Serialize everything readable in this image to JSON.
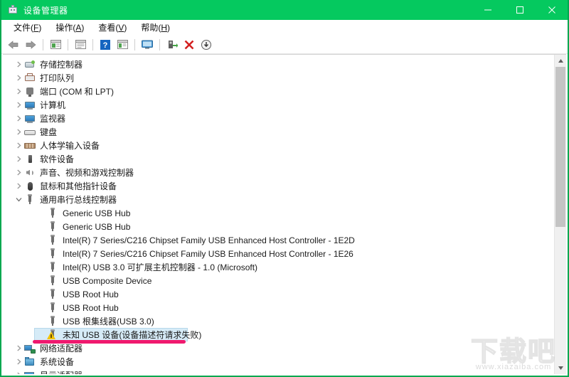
{
  "window": {
    "title": "设备管理器",
    "icon": "device-manager-icon",
    "accent_color": "#05c95f",
    "controls": [
      {
        "name": "minimize",
        "glyph": "minimize-icon"
      },
      {
        "name": "maximize",
        "glyph": "maximize-icon"
      },
      {
        "name": "close",
        "glyph": "close-icon"
      }
    ]
  },
  "menubar": {
    "items": [
      {
        "label": "文件(F)",
        "text": "文件(",
        "accel": "F",
        "tail": ")"
      },
      {
        "label": "操作(A)",
        "text": "操作(",
        "accel": "A",
        "tail": ")"
      },
      {
        "label": "查看(V)",
        "text": "查看(",
        "accel": "V",
        "tail": ")"
      },
      {
        "label": "帮助(H)",
        "text": "帮助(",
        "accel": "H",
        "tail": ")"
      }
    ]
  },
  "toolbar": {
    "buttons": [
      {
        "name": "back-icon"
      },
      {
        "name": "forward-icon"
      },
      {
        "name": "properties-icon"
      },
      {
        "name": "show-hidden-devices-icon"
      },
      {
        "name": "help-icon"
      },
      {
        "name": "update-driver-icon"
      },
      {
        "name": "scan-hardware-changes-icon"
      },
      {
        "name": "enable-device-icon"
      },
      {
        "name": "uninstall-device-icon"
      },
      {
        "name": "download-driver-icon"
      }
    ]
  },
  "tree": {
    "rows": [
      {
        "label": "存储控制器",
        "depth": 1,
        "expanded": false,
        "icon": "storage-controller-icon",
        "selected": false
      },
      {
        "label": "打印队列",
        "depth": 1,
        "expanded": false,
        "icon": "print-queue-icon",
        "selected": false
      },
      {
        "label": "端口 (COM 和 LPT)",
        "depth": 1,
        "expanded": false,
        "icon": "port-icon",
        "selected": false
      },
      {
        "label": "计算机",
        "depth": 1,
        "expanded": false,
        "icon": "computer-icon",
        "selected": false
      },
      {
        "label": "监视器",
        "depth": 1,
        "expanded": false,
        "icon": "monitor-icon",
        "selected": false
      },
      {
        "label": "键盘",
        "depth": 1,
        "expanded": false,
        "icon": "keyboard-icon",
        "selected": false
      },
      {
        "label": "人体学输入设备",
        "depth": 1,
        "expanded": false,
        "icon": "hid-icon",
        "selected": false
      },
      {
        "label": "软件设备",
        "depth": 1,
        "expanded": false,
        "icon": "software-device-icon",
        "selected": false
      },
      {
        "label": "声音、视频和游戏控制器",
        "depth": 1,
        "expanded": false,
        "icon": "sound-icon",
        "selected": false
      },
      {
        "label": "鼠标和其他指针设备",
        "depth": 1,
        "expanded": false,
        "icon": "mouse-icon",
        "selected": false
      },
      {
        "label": "通用串行总线控制器",
        "depth": 1,
        "expanded": true,
        "icon": "usb-icon",
        "selected": false
      },
      {
        "label": "Generic USB Hub",
        "depth": 2,
        "expanded": null,
        "icon": "usb-icon",
        "selected": false
      },
      {
        "label": "Generic USB Hub",
        "depth": 2,
        "expanded": null,
        "icon": "usb-icon",
        "selected": false
      },
      {
        "label": "Intel(R) 7 Series/C216 Chipset Family USB Enhanced Host Controller - 1E2D",
        "depth": 2,
        "expanded": null,
        "icon": "usb-icon",
        "selected": false
      },
      {
        "label": "Intel(R) 7 Series/C216 Chipset Family USB Enhanced Host Controller - 1E26",
        "depth": 2,
        "expanded": null,
        "icon": "usb-icon",
        "selected": false
      },
      {
        "label": "Intel(R) USB 3.0 可扩展主机控制器 - 1.0 (Microsoft)",
        "depth": 2,
        "expanded": null,
        "icon": "usb-icon",
        "selected": false
      },
      {
        "label": "USB Composite Device",
        "depth": 2,
        "expanded": null,
        "icon": "usb-icon",
        "selected": false
      },
      {
        "label": "USB Root Hub",
        "depth": 2,
        "expanded": null,
        "icon": "usb-icon",
        "selected": false
      },
      {
        "label": "USB Root Hub",
        "depth": 2,
        "expanded": null,
        "icon": "usb-icon",
        "selected": false
      },
      {
        "label": "USB 根集线器(USB 3.0)",
        "depth": 2,
        "expanded": null,
        "icon": "usb-icon",
        "selected": false
      },
      {
        "label": "未知 USB 设备(设备描述符请求失败)",
        "depth": 2,
        "expanded": null,
        "icon": "warning-icon",
        "selected": true
      },
      {
        "label": "网络适配器",
        "depth": 1,
        "expanded": false,
        "icon": "network-adapter-icon",
        "selected": false
      },
      {
        "label": "系统设备",
        "depth": 1,
        "expanded": false,
        "icon": "system-device-icon",
        "selected": false
      },
      {
        "label": "显示适配器",
        "depth": 1,
        "expanded": false,
        "icon": "display-adapter-icon",
        "selected": false
      }
    ]
  },
  "scrollbar": {
    "up_glyph": "chevron-up-icon",
    "down_glyph": "chevron-down-icon"
  },
  "annotation": {
    "underline_color": "#f0196e",
    "target": "未知 USB 设备(设备描述符请求失败)"
  },
  "watermark": {
    "logo": "下载吧",
    "url": "www.xiazaiba.com"
  }
}
